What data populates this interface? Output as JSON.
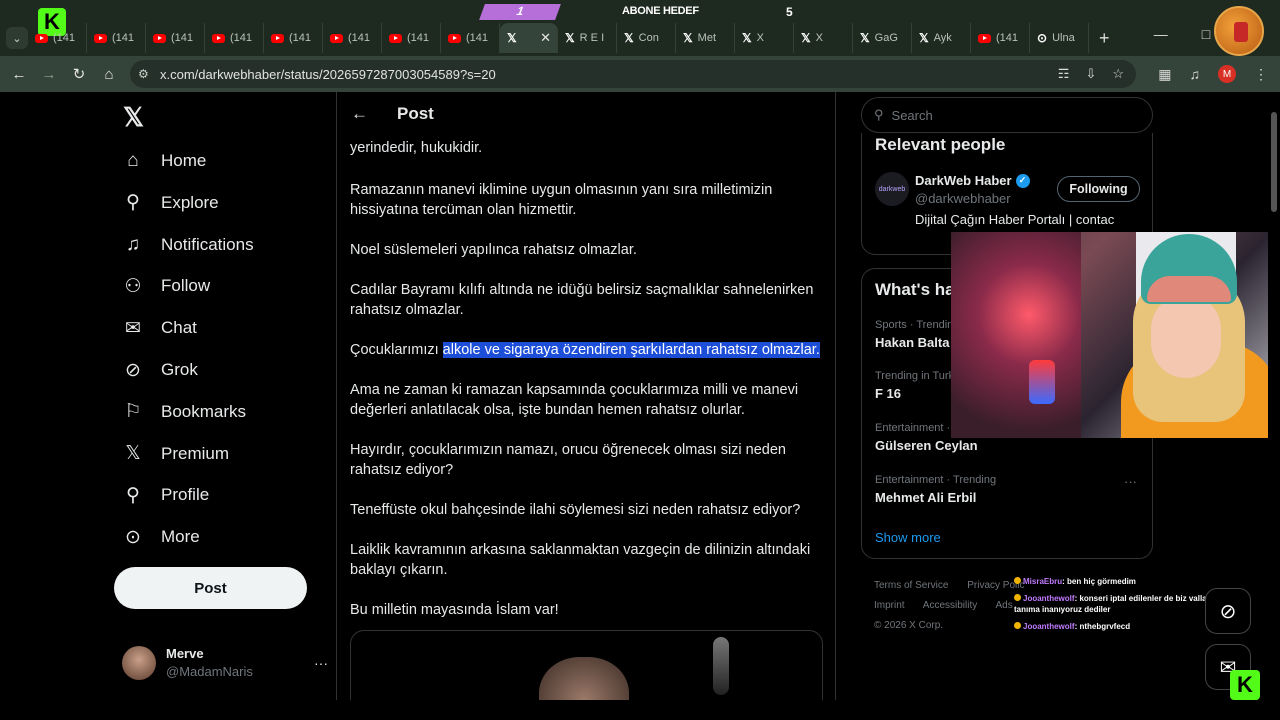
{
  "browser": {
    "tabs": [
      {
        "icon": "youtube",
        "label": "(141"
      },
      {
        "icon": "youtube",
        "label": "(141"
      },
      {
        "icon": "youtube",
        "label": "(141"
      },
      {
        "icon": "youtube",
        "label": "(141"
      },
      {
        "icon": "youtube",
        "label": "(141"
      },
      {
        "icon": "youtube",
        "label": "(141"
      },
      {
        "icon": "youtube",
        "label": "(141"
      },
      {
        "icon": "youtube",
        "label": "(141"
      },
      {
        "icon": "x",
        "label": "",
        "active": true
      },
      {
        "icon": "x",
        "label": "R E I"
      },
      {
        "icon": "x",
        "label": "Con"
      },
      {
        "icon": "x",
        "label": "Met"
      },
      {
        "icon": "x",
        "label": "X"
      },
      {
        "icon": "x",
        "label": "X"
      },
      {
        "icon": "x",
        "label": "GaG"
      },
      {
        "icon": "x",
        "label": "Ayk"
      },
      {
        "icon": "youtube",
        "label": "(141"
      },
      {
        "icon": "globe",
        "label": "Ulna"
      }
    ],
    "url": "x.com/darkwebhaber/status/2026597287003054589?s=20",
    "profile_initial": "M"
  },
  "stream": {
    "banner_left": "1",
    "banner_goal": "ABONE HEDEF",
    "banner_right": "5",
    "kick_logo": "K",
    "chat": [
      {
        "user": "MisraEbru",
        "message": "ben hiç görmedim"
      },
      {
        "user": "Jooanthewolf",
        "message": "konseri iptal edilenler de biz valla tanıma inanıyoruz dediler"
      },
      {
        "user": "Jooanthewolf",
        "message": "nthebgrvfecd"
      }
    ]
  },
  "nav": {
    "items": [
      {
        "icon": "home-icon",
        "label": "Home"
      },
      {
        "icon": "explore-icon",
        "label": "Explore"
      },
      {
        "icon": "bell-icon",
        "label": "Notifications"
      },
      {
        "icon": "follow-icon",
        "label": "Follow"
      },
      {
        "icon": "mail-icon",
        "label": "Chat"
      },
      {
        "icon": "grok-icon",
        "label": "Grok"
      },
      {
        "icon": "bookmark-icon",
        "label": "Bookmarks"
      },
      {
        "icon": "x-icon",
        "label": "Premium"
      },
      {
        "icon": "person-icon",
        "label": "Profile"
      },
      {
        "icon": "more-icon",
        "label": "More"
      }
    ],
    "post_label": "Post",
    "account": {
      "name": "Merve",
      "handle": "@MadamNaris"
    }
  },
  "main": {
    "title": "Post",
    "paragraphs": [
      {
        "text": "yerindedir, hukukidir."
      },
      {
        "text": "Ramazanın manevi iklimine uygun olmasının yanı sıra milletimizin hissiyatına tercüman olan hizmettir."
      },
      {
        "text": "Noel süslemeleri yapılınca rahatsız olmazlar."
      },
      {
        "text": "Cadılar Bayramı kılıfı altında ne idüğü belirsiz saçmalıklar sahnelenirken rahatsız olmazlar."
      },
      {
        "before": "Çocuklarımızı ",
        "highlight": "alkole ve sigaraya özendiren şarkılardan rahatsız olmazlar."
      },
      {
        "text": "Ama ne zaman ki ramazan kapsamında çocuklarımıza milli ve manevi değerleri anlatılacak olsa, işte bundan hemen rahatsız olurlar."
      },
      {
        "text": "Hayırdır, çocuklarımızın namazı, orucu öğrenecek olması sizi neden rahatsız ediyor?"
      },
      {
        "text": "Teneffüste okul bahçesinde ilahi söylemesi sizi neden rahatsız ediyor?"
      },
      {
        "text": "Laiklik kavramının arkasına saklanmaktan vazgeçin de dilinizin altındaki baklayı çıkarın."
      },
      {
        "text": "Bu milletin mayasında İslam var!"
      }
    ]
  },
  "right": {
    "search_placeholder": "Search",
    "relevant": {
      "title": "Relevant people",
      "name": "DarkWeb Haber",
      "handle": "@darkwebhaber",
      "bio": "Dijital Çağın Haber Portalı | contac",
      "follow_label": "Following",
      "avatar_text": "darkweb"
    },
    "happening": {
      "title": "What's ha",
      "trends": [
        {
          "meta": "Sports · Trendin",
          "topic": "Hakan Balta"
        },
        {
          "meta": "Trending in Turk",
          "topic": "F 16"
        },
        {
          "meta": "Entertainment ·",
          "topic": "Gülseren Ceylan"
        },
        {
          "meta": "Entertainment · Trending",
          "topic": "Mehmet Ali Erbil"
        }
      ],
      "show_more": "Show more"
    },
    "footer": [
      "Terms of Service",
      "Privacy Polic",
      "Imprint",
      "Accessibility",
      "Ads",
      "© 2026 X Corp."
    ]
  }
}
